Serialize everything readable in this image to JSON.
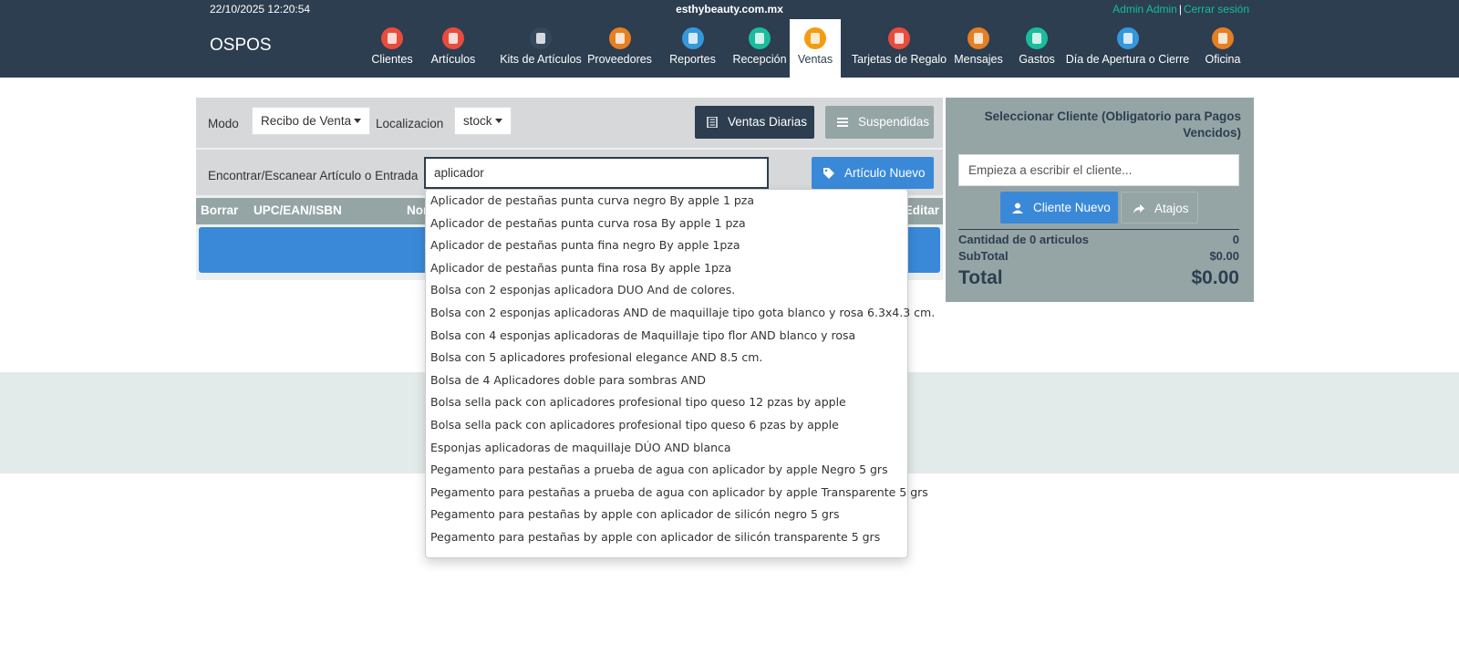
{
  "topbar": {
    "datetime": "22/10/2025 12:20:54",
    "host": "esthybeauty.com.mx",
    "user": "Admin Admin",
    "logout": "Cerrar sesión"
  },
  "brand": "OSPOS",
  "nav": [
    {
      "label": "Clientes",
      "icon": "clients-icon",
      "color": "#e74c3c"
    },
    {
      "label": "Artículos",
      "icon": "items-icon",
      "color": "#e74c3c"
    },
    {
      "label": "Kits de Artículos",
      "icon": "item-kits-icon",
      "color": "#34495e"
    },
    {
      "label": "Proveedores",
      "icon": "suppliers-icon",
      "color": "#e67e22"
    },
    {
      "label": "Reportes",
      "icon": "reports-icon",
      "color": "#3498db"
    },
    {
      "label": "Recepción",
      "icon": "receivings-icon",
      "color": "#1abc9c"
    },
    {
      "label": "Ventas",
      "icon": "sales-icon",
      "color": "#f39c12"
    },
    {
      "label": "Tarjetas de Regalo",
      "icon": "giftcards-icon",
      "color": "#e74c3c"
    },
    {
      "label": "Mensajes",
      "icon": "messages-icon",
      "color": "#e67e22"
    },
    {
      "label": "Gastos",
      "icon": "expenses-icon",
      "color": "#1abc9c"
    },
    {
      "label": "Día de Apertura o Cierre",
      "icon": "cashups-icon",
      "color": "#3498db"
    },
    {
      "label": "Oficina",
      "icon": "office-icon",
      "color": "#e67e22"
    }
  ],
  "register": {
    "mode_label": "Modo",
    "mode_value": "Recibo de Venta",
    "location_label": "Localizacion",
    "location_value": "stock",
    "daily_sales": "Ventas Diarias",
    "suspended": "Suspendidas",
    "find_label": "Encontrar/Escanear Artículo o Entrada",
    "search_value": "aplicador",
    "new_item": "Artículo Nuevo",
    "columns": {
      "delete": "Borrar",
      "upc": "UPC/EAN/ISBN",
      "name": "Nor",
      "edit": "Editar"
    }
  },
  "autocomplete": [
    "Aplicador de pestañas punta curva negro By apple 1 pza",
    "Aplicador de pestañas punta curva rosa By apple 1 pza",
    "Aplicador de pestañas punta fina negro By apple 1pza",
    "Aplicador de pestañas punta fina rosa By apple 1pza",
    "Bolsa con 2 esponjas aplicadora DUO And de colores.",
    "Bolsa con 2 esponjas aplicadoras AND de maquillaje tipo gota blanco y rosa 6.3x4.3 cm.",
    "Bolsa con 4 esponjas aplicadoras de Maquillaje tipo flor AND blanco y rosa",
    "Bolsa con 5 aplicadores profesional elegance AND 8.5 cm.",
    "Bolsa de 4 Aplicadores doble para sombras AND",
    "Bolsa sella pack con aplicadores profesional tipo queso 12 pzas by apple",
    "Bolsa sella pack con aplicadores profesional tipo queso 6 pzas by apple",
    "Esponjas aplicadoras de maquillaje DÚO AND blanca",
    "Pegamento para pestañas a prueba de agua con aplicador by apple Negro 5 grs",
    "Pegamento para pestañas a prueba de agua con aplicador by apple Transparente 5 grs",
    "Pegamento para pestañas by apple con aplicador de silicón negro 5 grs",
    "Pegamento para pestañas by apple con aplicador de silicón transparente 5 grs"
  ],
  "customer": {
    "select_label": "Seleccionar Cliente (Obligatorio para Pagos Vencidos)",
    "placeholder": "Empieza a escribir el cliente...",
    "new_customer": "Cliente Nuevo",
    "shortcuts": "Atajos",
    "qty_label": "Cantidad de 0 articulos",
    "qty_value": "0",
    "subtotal_label": "SubTotal",
    "subtotal_value": "$0.00",
    "total_label": "Total",
    "total_value": "$0.00"
  }
}
